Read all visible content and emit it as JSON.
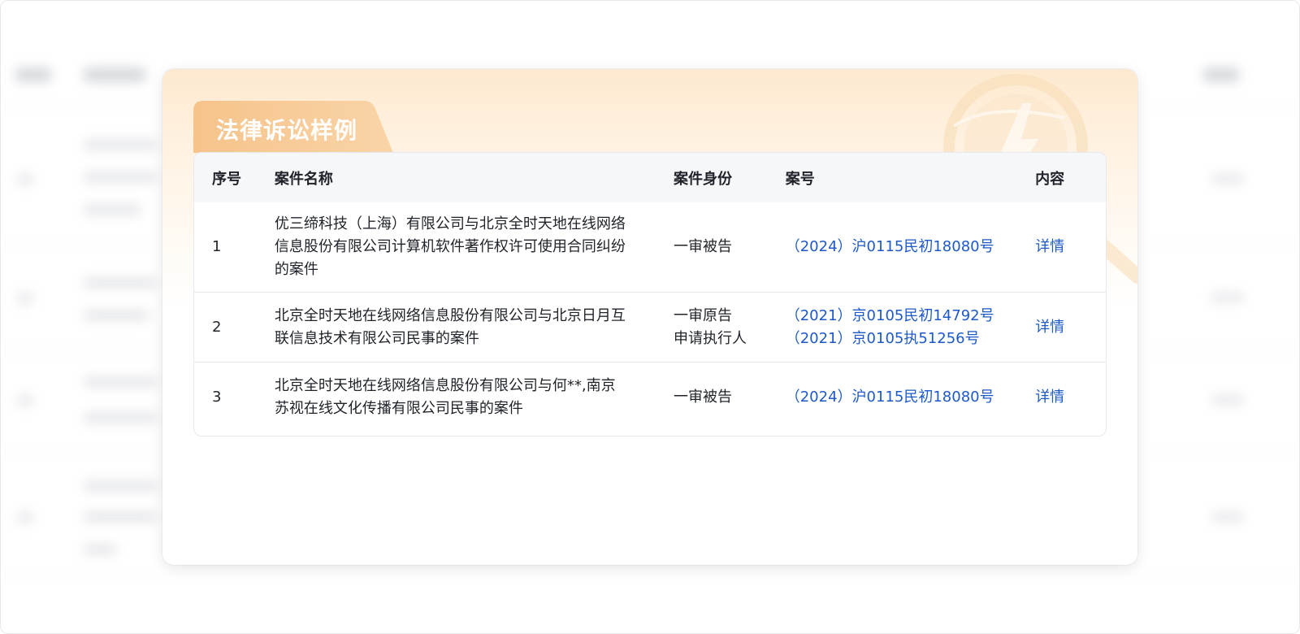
{
  "modal": {
    "title": "法律诉讼样例"
  },
  "table": {
    "headers": {
      "index": "序号",
      "name": "案件名称",
      "role": "案件身份",
      "case_no": "案号",
      "detail": "内容"
    },
    "rows": [
      {
        "index": "1",
        "name_lines": [
          "优三缔科技（上海）有限公司与北京全时天地在线网络",
          "信息股份有限公司计算机软件著作权许可使用合同纠纷",
          "的案件"
        ],
        "roles": [
          "一审被告"
        ],
        "case_nos": [
          "（2024）沪0115民初18080号"
        ],
        "detail": "详情"
      },
      {
        "index": "2",
        "name_lines": [
          "北京全时天地在线网络信息股份有限公司与北京日月互",
          "联信息技术有限公司民事的案件"
        ],
        "roles": [
          "一审原告",
          "申请执行人"
        ],
        "case_nos": [
          "（2021）京0105民初14792号",
          "（2021）京0105执51256号"
        ],
        "detail": "详情"
      },
      {
        "index": "3",
        "name_lines": [
          "北京全时天地在线网络信息股份有限公司与何**,南京",
          "苏视在线文化传播有限公司民事的案件"
        ],
        "roles": [
          "一审被告"
        ],
        "case_nos": [
          "（2024）沪0115民初18080号"
        ],
        "detail": "详情"
      }
    ]
  },
  "colors": {
    "link": "#1d59c8",
    "title_tab": "#f6c58f",
    "header_bg": "#f6f7f9"
  }
}
